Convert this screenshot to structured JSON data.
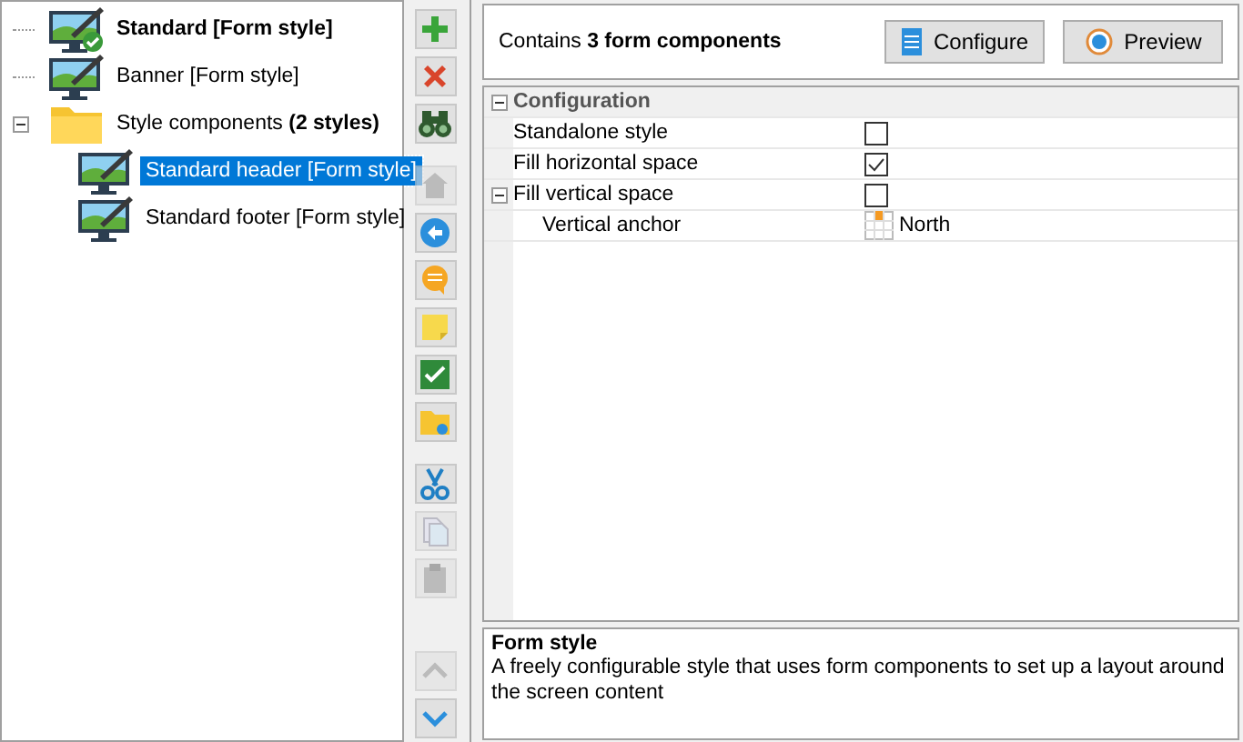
{
  "tree": [
    {
      "label": "Standard [Form style]",
      "kind": "style",
      "bold": true,
      "default": true,
      "selected": false
    },
    {
      "label": "Banner [Form style]",
      "kind": "style",
      "bold": false,
      "default": false,
      "selected": false
    },
    {
      "label": "Style components **(2 styles)**",
      "kind": "folder",
      "bold": false,
      "selected": false,
      "expanded": true,
      "children": [
        {
          "label": "Standard header [Form style]",
          "kind": "style",
          "bold": false,
          "default": false,
          "selected": true
        },
        {
          "label": "Standard footer [Form style]",
          "kind": "style",
          "bold": false,
          "default": false,
          "selected": false
        }
      ]
    }
  ],
  "toolbar": [
    [
      {
        "kind": "add",
        "disabled": false
      },
      {
        "kind": "delete",
        "disabled": false
      },
      {
        "kind": "find",
        "disabled": false
      }
    ],
    [
      {
        "kind": "home",
        "disabled": true
      },
      {
        "kind": "back",
        "disabled": false
      },
      {
        "kind": "comment",
        "disabled": false
      },
      {
        "kind": "note",
        "disabled": false
      },
      {
        "kind": "check",
        "disabled": false
      },
      {
        "kind": "folder",
        "disabled": false
      }
    ],
    [
      {
        "kind": "cut",
        "disabled": false
      },
      {
        "kind": "copy",
        "disabled": true
      },
      {
        "kind": "paste",
        "disabled": true
      }
    ],
    [
      {
        "kind": "up",
        "disabled": true
      },
      {
        "kind": "down",
        "disabled": false
      }
    ]
  ],
  "header": {
    "summary": "Contains **3 form components**",
    "buttons": [
      {
        "label": "Configure",
        "kind": "configure"
      },
      {
        "label": "Preview",
        "kind": "preview"
      }
    ]
  },
  "properties": [
    {
      "kind": "section",
      "label": "Configuration",
      "expanded": true,
      "children": [
        {
          "kind": "checkbox",
          "label": "Standalone style",
          "checked": false
        },
        {
          "kind": "checkbox",
          "label": "Fill horizontal space",
          "checked": true
        },
        {
          "kind": "checkbox",
          "label": "Fill vertical space",
          "checked": false,
          "expanded": true,
          "children": [
            {
              "kind": "anchor",
              "label": "Vertical anchor",
              "value": "North"
            }
          ]
        }
      ]
    }
  ],
  "description": {
    "title": "Form style",
    "text": "A freely configurable style that uses form components to set up a layout around the screen content"
  }
}
